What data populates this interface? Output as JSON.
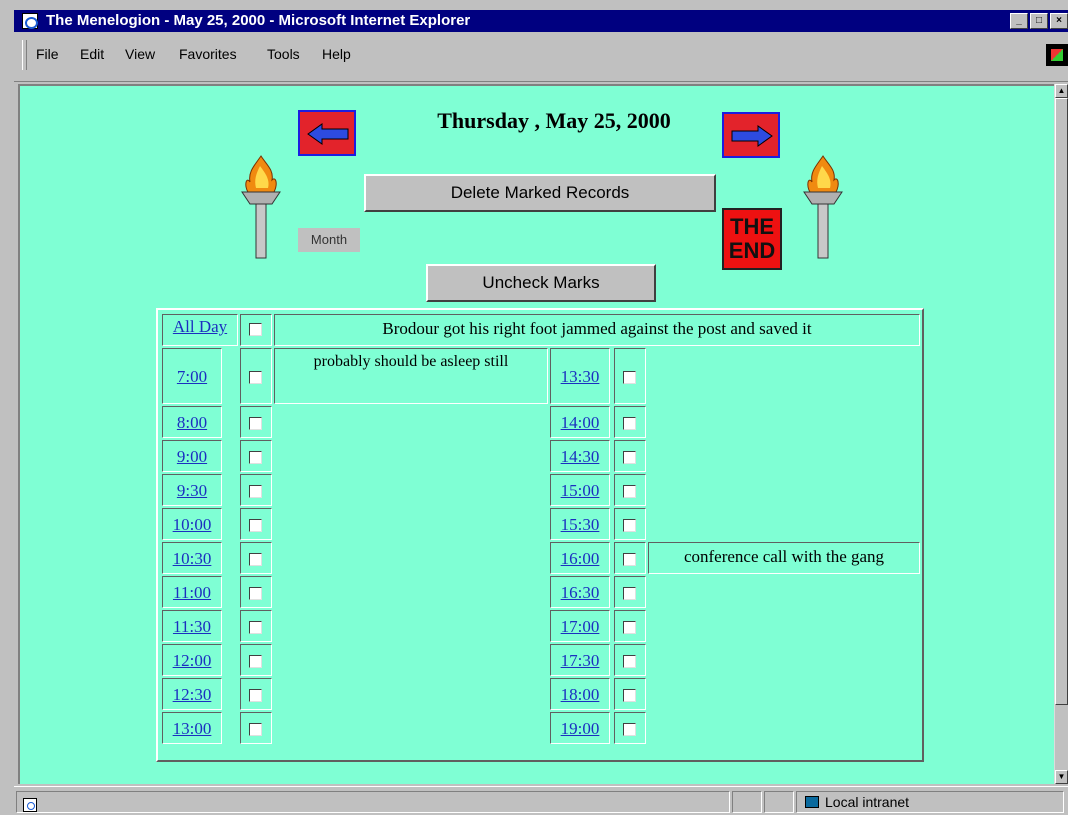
{
  "window": {
    "title": "The Menelogion - May 25, 2000 - Microsoft Internet Explorer"
  },
  "menu": {
    "items": [
      "File",
      "Edit",
      "View",
      "Favorites",
      "Tools",
      "Help"
    ]
  },
  "page": {
    "heading": "Thursday , May 25, 2000",
    "delete_label": "Delete Marked Records",
    "uncheck_label": "Uncheck Marks",
    "month_label": "Month",
    "the_end_line1": "THE",
    "the_end_line2": "END"
  },
  "schedule": {
    "allday": {
      "label": "All Day",
      "event": "Brodour got his right foot jammed against the post and saved it"
    },
    "left": [
      {
        "time": "7:00",
        "event": "probably should be asleep still"
      },
      {
        "time": "8:00",
        "event": ""
      },
      {
        "time": "9:00",
        "event": ""
      },
      {
        "time": "9:30",
        "event": ""
      },
      {
        "time": "10:00",
        "event": ""
      },
      {
        "time": "10:30",
        "event": ""
      },
      {
        "time": "11:00",
        "event": ""
      },
      {
        "time": "11:30",
        "event": ""
      },
      {
        "time": "12:00",
        "event": ""
      },
      {
        "time": "12:30",
        "event": ""
      },
      {
        "time": "13:00",
        "event": ""
      }
    ],
    "right": [
      {
        "time": "13:30",
        "event": ""
      },
      {
        "time": "14:00",
        "event": ""
      },
      {
        "time": "14:30",
        "event": ""
      },
      {
        "time": "15:00",
        "event": ""
      },
      {
        "time": "15:30",
        "event": ""
      },
      {
        "time": "16:00",
        "event": "conference call with the gang"
      },
      {
        "time": "16:30",
        "event": ""
      },
      {
        "time": "17:00",
        "event": ""
      },
      {
        "time": "17:30",
        "event": ""
      },
      {
        "time": "18:00",
        "event": ""
      },
      {
        "time": "19:00",
        "event": ""
      }
    ]
  },
  "status": {
    "zone": "Local intranet"
  }
}
